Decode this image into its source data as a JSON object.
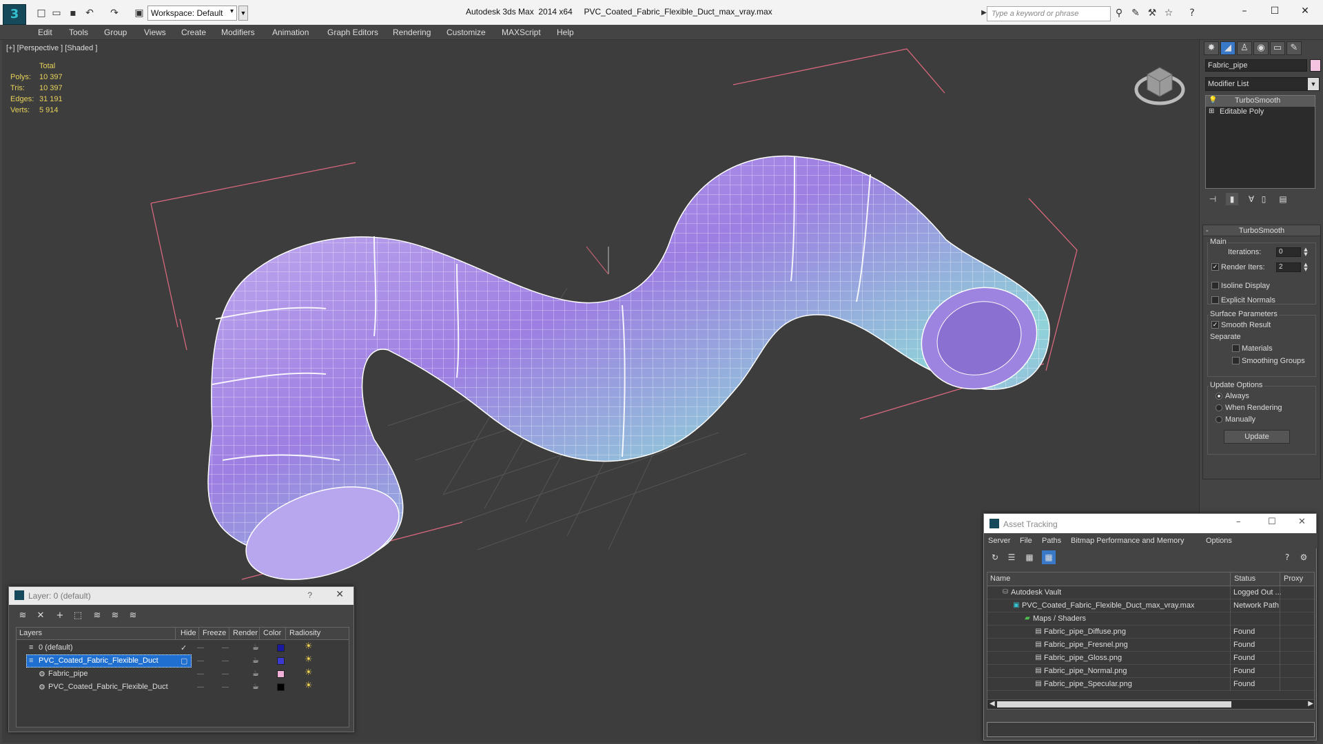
{
  "app": {
    "title": "Autodesk 3ds Max  2014 x64",
    "file": "PVC_Coated_Fabric_Flexible_Duct_max_vray.max",
    "logo": "3",
    "workspace": "Workspace: Default",
    "search_placeholder": "Type a keyword or phrase"
  },
  "menu": [
    "Edit",
    "Tools",
    "Group",
    "Views",
    "Create",
    "Modifiers",
    "Animation",
    "Graph Editors",
    "Rendering",
    "Customize",
    "MAXScript",
    "Help"
  ],
  "viewport": {
    "label": "[+] [Perspective ] [Shaded ]",
    "stats": {
      "header": "Total",
      "rows": [
        {
          "k": "Polys:",
          "v": "10 397"
        },
        {
          "k": "Tris:",
          "v": "10 397"
        },
        {
          "k": "Edges:",
          "v": "31 191"
        },
        {
          "k": "Verts:",
          "v": "5 914"
        }
      ]
    },
    "colors": {
      "mesh_fill": "#a68be6",
      "bbox": "#d9687c",
      "wire": "#ffffff",
      "grid": "#555555"
    }
  },
  "command_panel": {
    "object_name": "Fabric_pipe",
    "object_color": "#f4c3e0",
    "modifier_list": "Modifier List",
    "stack": [
      "TurboSmooth",
      "Editable Poly"
    ],
    "rollout": {
      "title": "TurboSmooth",
      "main_label": "Main",
      "iterations_label": "Iterations:",
      "iterations_value": "0",
      "render_iters_label": "Render Iters:",
      "render_iters_value": "2",
      "isoline_label": "Isoline Display",
      "explicit_normals_label": "Explicit Normals",
      "surface_label": "Surface Parameters",
      "smooth_result_label": "Smooth Result",
      "separate_label": "Separate",
      "materials_label": "Materials",
      "smoothing_groups_label": "Smoothing Groups",
      "update_options_label": "Update Options",
      "always_label": "Always",
      "when_rendering_label": "When Rendering",
      "manually_label": "Manually",
      "update_button": "Update"
    }
  },
  "layer_window": {
    "title": "Layer: 0 (default)",
    "help": "?",
    "columns": [
      "Layers",
      "Hide",
      "Freeze",
      "Render",
      "Color",
      "Radiosity"
    ],
    "rows": [
      {
        "name": "0 (default)",
        "color": "#1a1aa0",
        "selected": false
      },
      {
        "name": "PVC_Coated_Fabric_Flexible_Duct",
        "color": "#3a3ad0",
        "selected": true
      },
      {
        "name": "Fabric_pipe",
        "color": "#f0b0d8",
        "selected": false
      },
      {
        "name": "PVC_Coated_Fabric_Flexible_Duct",
        "color": "#000000",
        "selected": false
      }
    ]
  },
  "asset_window": {
    "title": "Asset Tracking",
    "menu": [
      "Server",
      "File",
      "Paths",
      "Bitmap Performance and Memory",
      "Options"
    ],
    "columns": [
      "Name",
      "Status",
      "Proxy"
    ],
    "rows": [
      {
        "name": "Autodesk Vault",
        "status": "Logged Out ..."
      },
      {
        "name": "PVC_Coated_Fabric_Flexible_Duct_max_vray.max",
        "status": "Network Path"
      },
      {
        "name": "Maps / Shaders",
        "status": ""
      },
      {
        "name": "Fabric_pipe_Diffuse.png",
        "status": "Found"
      },
      {
        "name": "Fabric_pipe_Fresnel.png",
        "status": "Found"
      },
      {
        "name": "Fabric_pipe_Gloss.png",
        "status": "Found"
      },
      {
        "name": "Fabric_pipe_Normal.png",
        "status": "Found"
      },
      {
        "name": "Fabric_pipe_Specular.png",
        "status": "Found"
      }
    ]
  }
}
